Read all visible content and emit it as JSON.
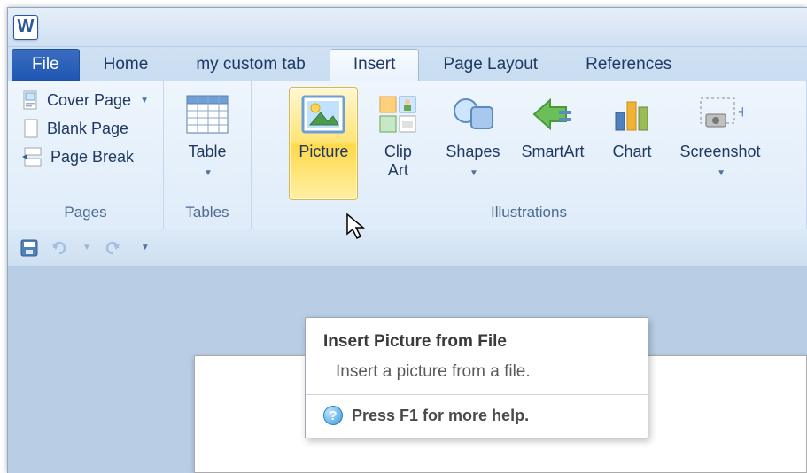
{
  "app": {
    "letter": "W"
  },
  "tabs": {
    "file": "File",
    "home": "Home",
    "custom": "my custom tab",
    "insert": "Insert",
    "layout": "Page Layout",
    "references": "References"
  },
  "groups": {
    "pages": {
      "label": "Pages",
      "cover": "Cover Page",
      "blank": "Blank Page",
      "break": "Page Break"
    },
    "tables": {
      "label": "Tables",
      "table": "Table"
    },
    "illustrations": {
      "label": "Illustrations",
      "picture": "Picture",
      "clipart": "Clip\nArt",
      "shapes": "Shapes",
      "smartart": "SmartArt",
      "chart": "Chart",
      "screenshot": "Screenshot"
    }
  },
  "tooltip": {
    "title": "Insert Picture from File",
    "body": "Insert a picture from a file.",
    "help": "Press F1 for more help."
  }
}
